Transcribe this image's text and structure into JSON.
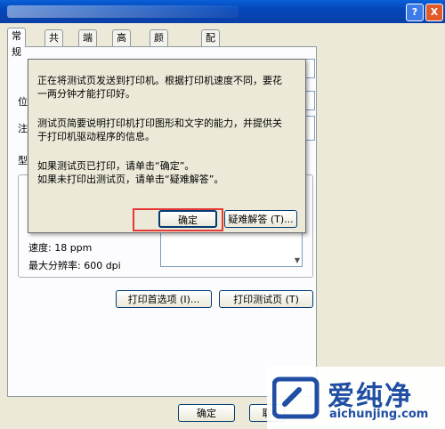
{
  "window": {
    "help_button": "?",
    "close_button": "X"
  },
  "tabs": [
    {
      "label": "常规"
    },
    {
      "label": "共享"
    },
    {
      "label": "端口"
    },
    {
      "label": "高级"
    },
    {
      "label": "颜色管理"
    },
    {
      "label": "配置"
    }
  ],
  "general": {
    "partial_labels": [
      "位",
      "注",
      "型"
    ],
    "speed_label": "速度: 18 ppm",
    "resolution_label": "最大分辨率: 600 dpi",
    "preferences_button": "打印首选项 (I)...",
    "test_page_button": "打印测试页 (T)"
  },
  "dialog": {
    "message_1_line_1": "正在将测试页发送到打印机。根据打印机速度不同，要花",
    "message_1_line_2": "一两分钟才能打印好。",
    "message_2_line_1": "测试页简要说明打印机打印图形和文字的能力，并提供关",
    "message_2_line_2": "于打印机驱动程序的信息。",
    "message_3_line_1": "如果测试页已打印，请单击“确定”。",
    "message_3_line_2": "如果未打印出测试页，请单击“疑难解答”。",
    "ok_button": "确定",
    "troubleshoot_button": "疑难解答 (T)..."
  },
  "footer": {
    "ok_button": "确定",
    "cancel_button_partial": "取"
  },
  "watermark": {
    "brand": "爱纯净",
    "url": "aichunjing.com"
  },
  "colors": {
    "highlight": "#e53935",
    "watermark": "#1f4ea3"
  }
}
